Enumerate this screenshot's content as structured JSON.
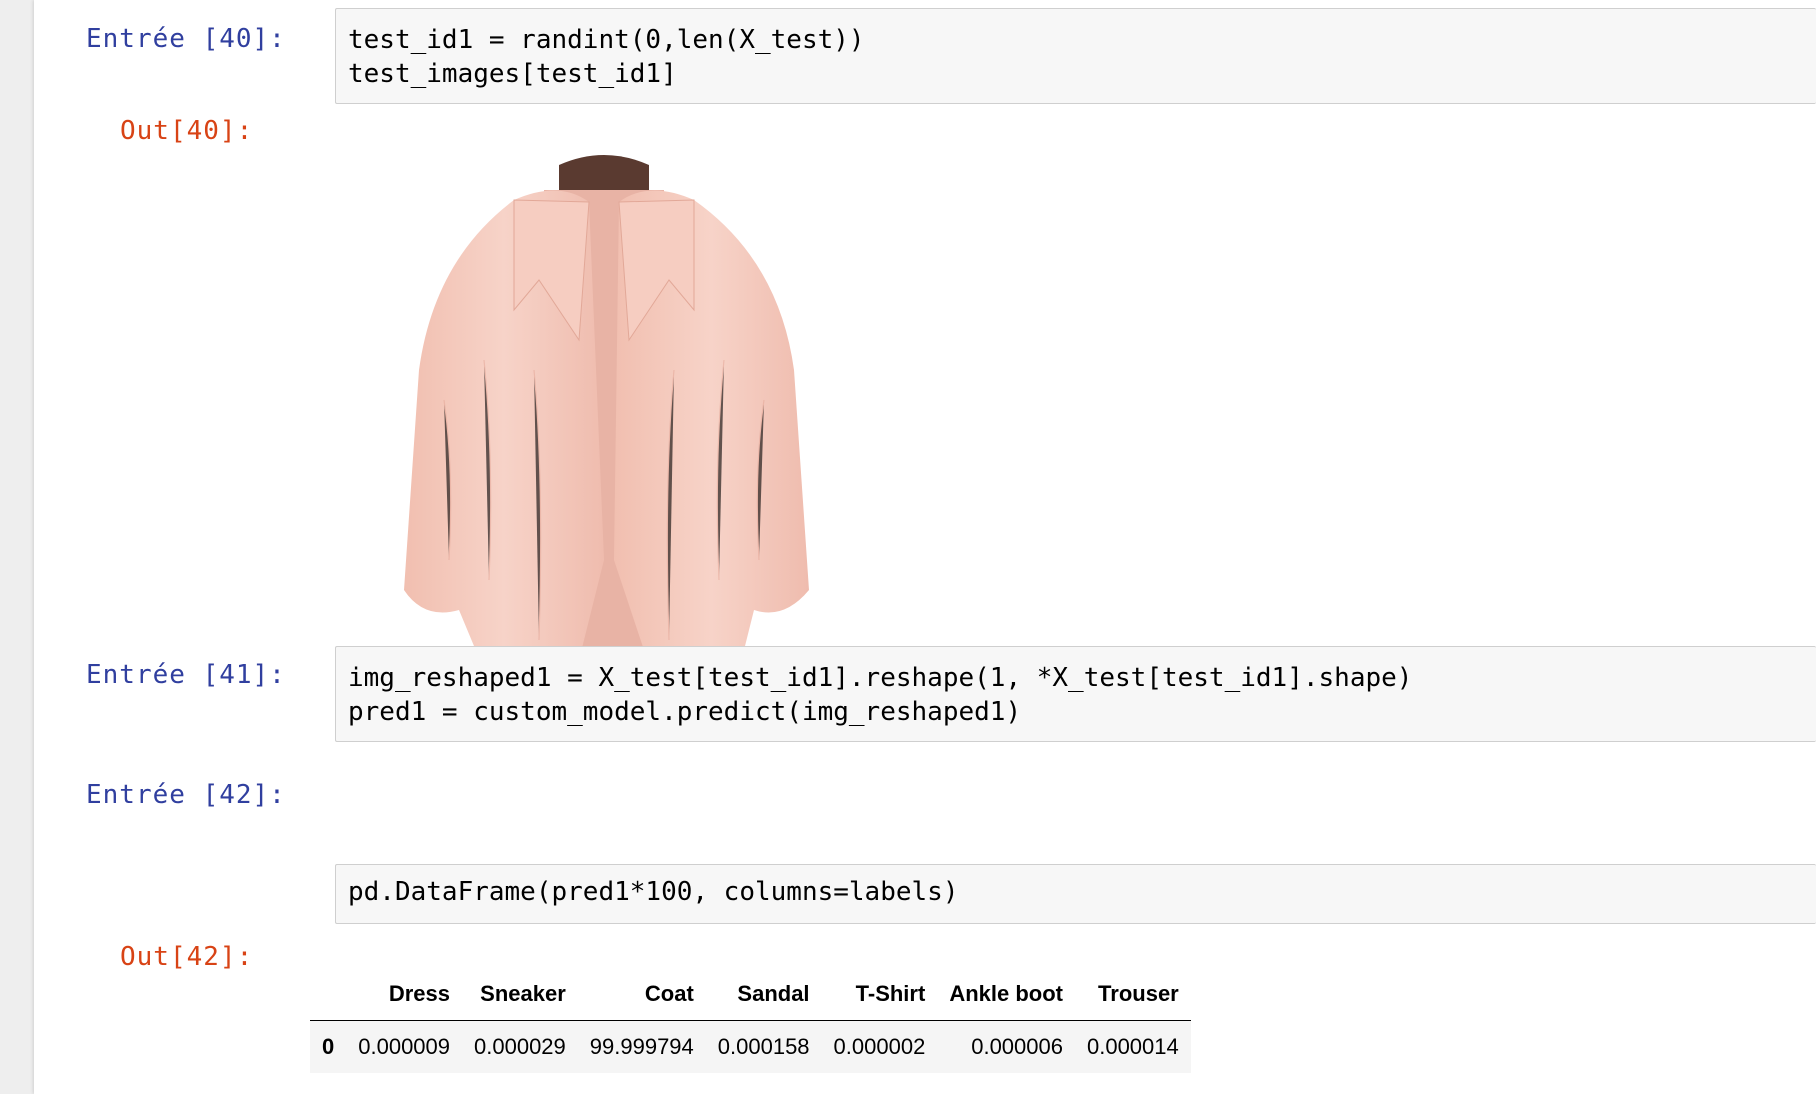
{
  "cells": [
    {
      "in_prompt": "Entrée [40]:",
      "code": [
        "test_id1 = randint(0,len(X_test))",
        "test_images[test_id1]"
      ],
      "out_prompt": "Out[40]:",
      "output_image": "pink-fur-coat-image"
    },
    {
      "in_prompt": "Entrée [41]:",
      "code": [
        "img_reshaped1 = X_test[test_id1].reshape(1, *X_test[test_id1].shape)",
        "pred1 = custom_model.predict(img_reshaped1)"
      ]
    },
    {
      "in_prompt": "Entrée [42]:",
      "code": [
        "pd.DataFrame(pred1*100, columns=labels)"
      ],
      "out_prompt": "Out[42]:"
    }
  ],
  "dataframe": {
    "columns": [
      "",
      "Dress",
      "Sneaker",
      "Coat",
      "Sandal",
      "T-Shirt",
      "Ankle boot",
      "Trouser"
    ],
    "rows": [
      [
        "0",
        "0.000009",
        "0.000029",
        "99.999794",
        "0.000158",
        "0.000002",
        "0.000006",
        "0.000014"
      ]
    ]
  },
  "colors": {
    "in_prompt": "#303f9f",
    "out_prompt": "#d84315",
    "operator": "#aa22ff",
    "number": "#008000",
    "coat": "#f4c7bb"
  }
}
